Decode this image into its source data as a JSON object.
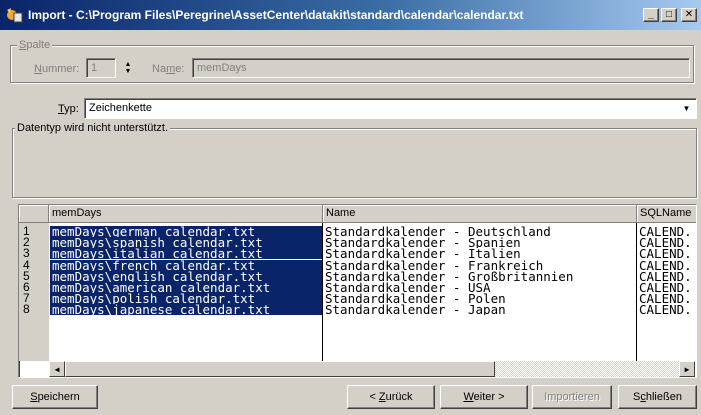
{
  "window": {
    "title": "Import - C:\\Program Files\\Peregrine\\AssetCenter\\datakit\\standard\\calendar\\calendar.txt",
    "icon": "import-app-icon",
    "minimize_glyph": "_",
    "maximize_glyph": "□",
    "close_glyph": "✕"
  },
  "column_group": {
    "legend_first": "S",
    "legend_rest": "palte",
    "number_label_first": "N",
    "number_label_rest": "ummer:",
    "number_value": "1",
    "name_label_pre": "Na",
    "name_label_u": "m",
    "name_label_post": "e:",
    "name_value": "memDays"
  },
  "type_field": {
    "label_first": "T",
    "label_rest": "yp:",
    "value": "Zeichenkette"
  },
  "datatype_group": {
    "legend": "Datentyp wird nicht unterstützt."
  },
  "grid": {
    "columns": [
      "memDays",
      "Name",
      "SQLName"
    ],
    "row_numbers": [
      "1",
      "2",
      "3",
      "4",
      "5",
      "6",
      "7",
      "8"
    ],
    "rows": [
      {
        "memDays": "memDays\\german_calendar.txt",
        "Name": "Standardkalender - Deutschland",
        "SQLName": "CALEND."
      },
      {
        "memDays": "memDays\\spanish_calendar.txt",
        "Name": "Standardkalender - Spanien",
        "SQLName": "CALEND."
      },
      {
        "memDays": "memDays\\italian_calendar.txt",
        "Name": "Standardkalender - Italien",
        "SQLName": "CALEND."
      },
      {
        "memDays": "memDays\\french_calendar.txt",
        "Name": "Standardkalender - Frankreich",
        "SQLName": "CALEND."
      },
      {
        "memDays": "memDays\\english_calendar.txt",
        "Name": "Standardkalender - Großbritannien",
        "SQLName": "CALEND."
      },
      {
        "memDays": "memDays\\american_calendar.txt",
        "Name": "Standardkalender - USA",
        "SQLName": "CALEND."
      },
      {
        "memDays": "memDays\\polish_calendar.txt",
        "Name": "Standardkalender - Polen",
        "SQLName": "CALEND."
      },
      {
        "memDays": "memDays\\japanese_calendar.txt",
        "Name": "Standardkalender - Japan",
        "SQLName": "CALEND."
      }
    ],
    "selected_column": "memDays",
    "scroll_left_glyph": "◀",
    "scroll_right_glyph": "▶"
  },
  "buttons": {
    "save_first": "S",
    "save_rest": "peichern",
    "back_pre": "< ",
    "back_u": "Z",
    "back_post": "urück",
    "next_u": "W",
    "next_post": "eiter >",
    "import": "Importieren",
    "close_pre": "S",
    "close_u": "c",
    "close_post": "hließen"
  },
  "colors": {
    "selection": "#0a246a",
    "face": "#d4d0c8",
    "title_start": "#0a246a",
    "title_end": "#a6caf0"
  }
}
